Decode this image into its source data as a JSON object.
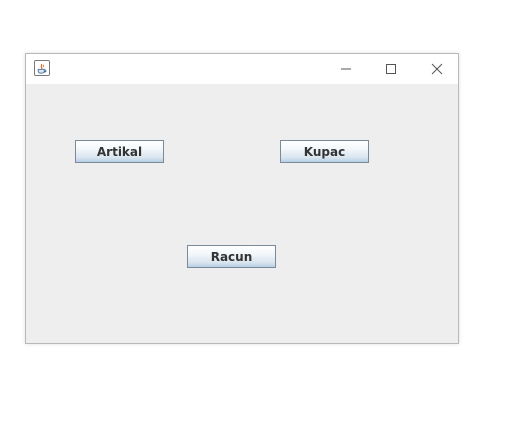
{
  "window": {
    "controls": {
      "minimize_icon": "minimize-icon",
      "maximize_icon": "maximize-icon",
      "close_icon": "close-icon"
    }
  },
  "buttons": {
    "artikal": "Artikal",
    "kupac": "Kupac",
    "racun": "Racun"
  },
  "colors": {
    "background": "#eeeeee",
    "button_border": "#7a8a99",
    "button_text": "#333333"
  }
}
